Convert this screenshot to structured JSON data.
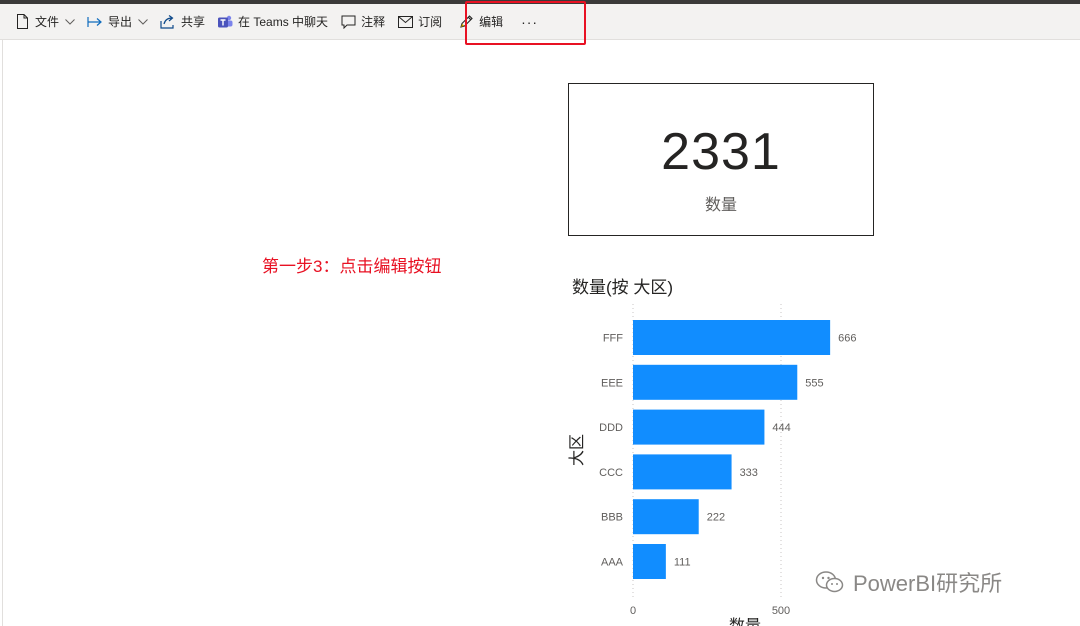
{
  "toolbar": {
    "file_label": "文件",
    "export_label": "导出",
    "share_label": "共享",
    "teams_label": "在 Teams 中聊天",
    "comment_label": "注释",
    "subscribe_label": "订阅",
    "edit_label": "编辑",
    "more_label": "···",
    "icons": {
      "file": "document-icon",
      "export": "export-arrow-icon",
      "share": "share-icon",
      "teams": "teams-icon",
      "comment": "comment-icon",
      "subscribe": "mail-icon",
      "edit": "pencil-icon",
      "dropdown": "chevron-down-icon"
    },
    "highlight_color": "#e81123"
  },
  "annotation": {
    "text": "第一步3：点击编辑按钮",
    "color": "#e81123"
  },
  "card": {
    "value": "2331",
    "label": "数量"
  },
  "chart_title": "数量(按 大区)",
  "chart_data": {
    "type": "bar",
    "orientation": "horizontal",
    "title": "数量(按 大区)",
    "categories": [
      "FFF",
      "EEE",
      "DDD",
      "CCC",
      "BBB",
      "AAA"
    ],
    "values": [
      666,
      555,
      444,
      333,
      222,
      111
    ],
    "data_labels": [
      "666",
      "555",
      "444",
      "333",
      "222",
      "111"
    ],
    "xlabel": "数量",
    "ylabel": "大区",
    "xlim": [
      0,
      680
    ],
    "x_ticks": [
      0,
      500
    ],
    "x_tick_labels": [
      "0",
      "500"
    ],
    "grid": true,
    "bar_color": "#118dff"
  },
  "watermark": {
    "text": "PowerBI研究所",
    "icon": "wechat-icon"
  }
}
